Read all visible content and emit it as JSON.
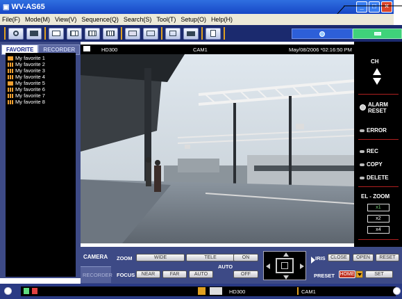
{
  "window": {
    "title": "WV-AS65"
  },
  "menu": [
    "File(F)",
    "Mode(M)",
    "View(V)",
    "Sequence(Q)",
    "Search(S)",
    "Tool(T)",
    "Setup(O)",
    "Help(H)"
  ],
  "tabs": {
    "favorite": "FAVORITE",
    "recorder": "RECORDER"
  },
  "favorites": [
    "My favorite 1",
    "My favorite 2",
    "My favorite 3",
    "My favorite 4",
    "My favorite 5",
    "My favorite 6",
    "My favorite 7",
    "My favorite 8"
  ],
  "video": {
    "recorder": "HD300",
    "camera": "CAM1",
    "datetime": "May/08/2006 *02:16:50 PM"
  },
  "right_panel": {
    "ch": "CH",
    "alarm_reset": "ALARM\nRESET",
    "error": "ERROR",
    "rec": "REC",
    "copy": "COPY",
    "delete": "DELETE",
    "el_zoom": "EL - ZOOM",
    "zoom_levels": [
      "x1",
      "x2",
      "x4"
    ]
  },
  "controls": {
    "camera_tab": "CAMERA",
    "recorder_tab": "RECORDER",
    "zoom": "ZOOM",
    "wide": "WIDE",
    "tele": "TELE",
    "focus": "FOCUS",
    "near": "NEAR",
    "far": "FAR",
    "auto": "AUTO",
    "auto_label": "AUTO",
    "on": "ON",
    "off": "OFF",
    "iris": "IRIS",
    "close": "CLOSE",
    "open": "OPEN",
    "reset": "RESET",
    "preset": "PRESET",
    "home": "HOME",
    "set": "SET"
  },
  "statusbar": {
    "recorder": "HD300",
    "camera": "CAM1"
  },
  "colors": {
    "panel": "#3d4a86",
    "accent_red": "#b02020",
    "status_orange": "#e0a020"
  }
}
